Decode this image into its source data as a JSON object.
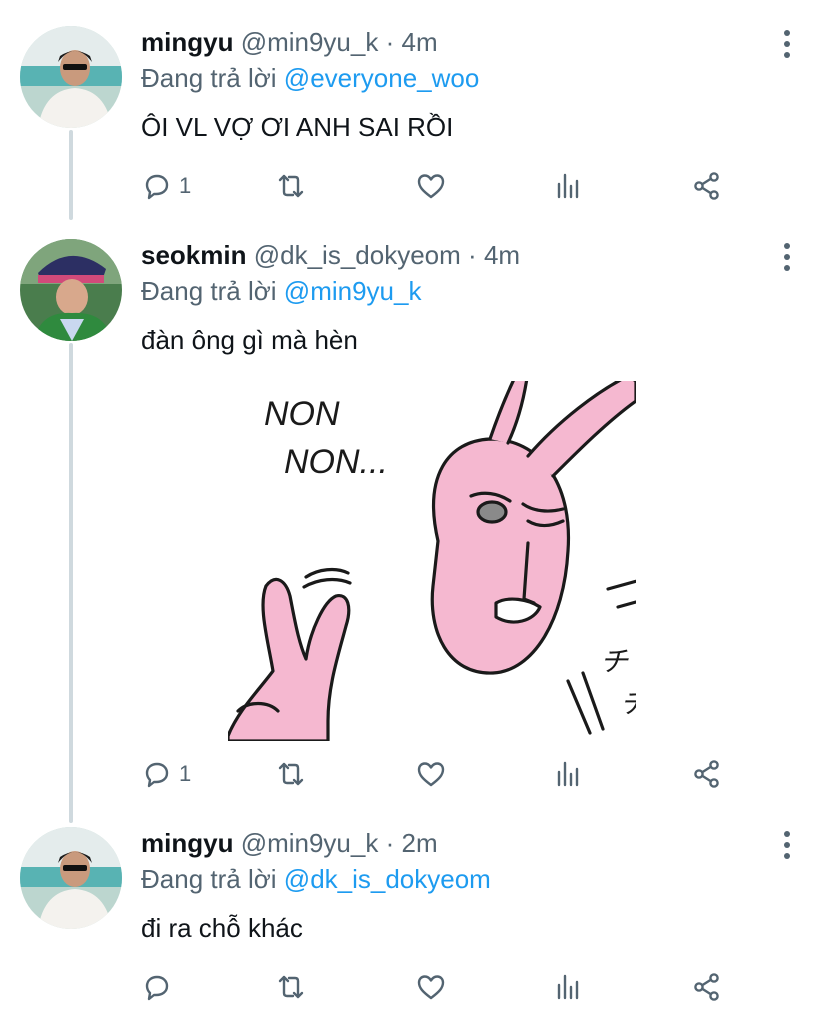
{
  "tweets": [
    {
      "name": "mingyu",
      "handle": "@min9yu_k",
      "separator": "·",
      "time": "4m",
      "replying_label": "Đang trả lời",
      "replying_to": "@everyone_woo",
      "text": "ÔI VL VỢ ƠI ANH SAI RỒI",
      "reply_count": "1"
    },
    {
      "name": "seokmin",
      "handle": "@dk_is_dokyeom",
      "separator": "·",
      "time": "4m",
      "replying_label": "Đang trả lời",
      "replying_to": "@min9yu_k",
      "text": "đàn ông gì mà hèn",
      "reply_count": "1",
      "image_text": {
        "line1": "NON",
        "line2": "NON...",
        "sfx1": "チッ",
        "sfx2": "チッ"
      }
    },
    {
      "name": "mingyu",
      "handle": "@min9yu_k",
      "separator": "·",
      "time": "2m",
      "replying_label": "Đang trả lời",
      "replying_to": "@dk_is_dokyeom",
      "text": "đi ra chỗ khác",
      "reply_count": ""
    }
  ],
  "icons": {
    "reply": "reply-icon",
    "retweet": "retweet-icon",
    "like": "like-icon",
    "analytics": "analytics-icon",
    "share": "share-icon",
    "more": "more-vertical-icon"
  },
  "colors": {
    "link": "#1d9bf0",
    "secondary_text": "#536471",
    "thread_line": "#cfd9de",
    "sticker_pink": "#f5b8d0"
  }
}
